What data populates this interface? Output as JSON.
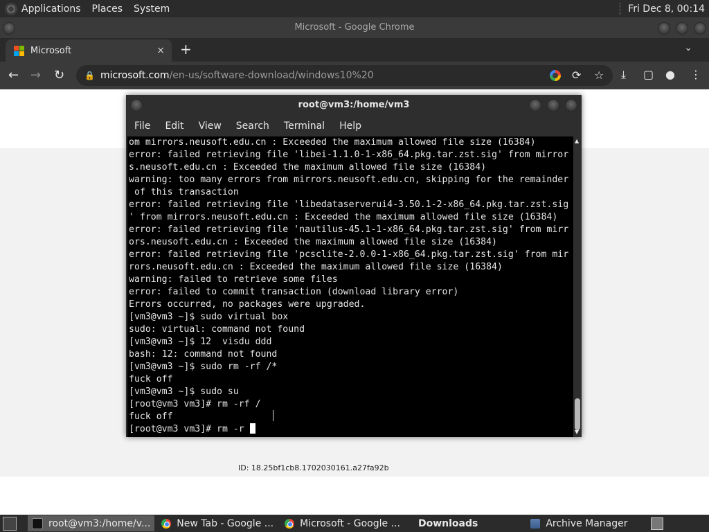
{
  "top_panel": {
    "menus": [
      "Applications",
      "Places",
      "System"
    ],
    "clock": "Fri Dec 8, 00:14"
  },
  "chrome": {
    "window_title": "Microsoft - Google Chrome",
    "tab": {
      "title": "Microsoft",
      "close": "×"
    },
    "new_tab": "+",
    "tab_menu": "⌄",
    "url_host": "microsoft.com",
    "url_path": "/en-us/software-download/windows10%20",
    "icons": [
      "back-icon",
      "forward-icon",
      "reload-icon",
      "lock-icon",
      "google-lens-icon",
      "share-icon",
      "star-icon",
      "download-icon",
      "side-panel-icon",
      "profile-icon",
      "more-icon"
    ]
  },
  "page": {
    "id_text": "ID: 18.25bf1cb8.1702030161.a27fa92b"
  },
  "terminal": {
    "title": "root@vm3:/home/vm3",
    "menu": [
      "File",
      "Edit",
      "View",
      "Search",
      "Terminal",
      "Help"
    ],
    "lines": [
      "om mirrors.neusoft.edu.cn : Exceeded the maximum allowed file size (16384)",
      "error: failed retrieving file 'libei-1.1.0-1-x86_64.pkg.tar.zst.sig' from mirror",
      "s.neusoft.edu.cn : Exceeded the maximum allowed file size (16384)",
      "warning: too many errors from mirrors.neusoft.edu.cn, skipping for the remainder",
      " of this transaction",
      "error: failed retrieving file 'libedataserverui4-3.50.1-2-x86_64.pkg.tar.zst.sig",
      "' from mirrors.neusoft.edu.cn : Exceeded the maximum allowed file size (16384)",
      "error: failed retrieving file 'nautilus-45.1-1-x86_64.pkg.tar.zst.sig' from mirr",
      "ors.neusoft.edu.cn : Exceeded the maximum allowed file size (16384)",
      "error: failed retrieving file 'pcsclite-2.0.0-1-x86_64.pkg.tar.zst.sig' from mir",
      "rors.neusoft.edu.cn : Exceeded the maximum allowed file size (16384)",
      "warning: failed to retrieve some files",
      "error: failed to commit transaction (download library error)",
      "Errors occurred, no packages were upgraded.",
      "[vm3@vm3 ~]$ sudo virtual box",
      "sudo: virtual: command not found",
      "[vm3@vm3 ~]$ 12  visdu ddd",
      "bash: 12: command not found",
      "[vm3@vm3 ~]$ sudo rm -rf /*",
      "fuck off",
      "[vm3@vm3 ~]$ sudo su",
      "[root@vm3 vm3]# rm -rf /",
      "fuck off"
    ],
    "prompt_line": "[root@vm3 vm3]# rm -r "
  },
  "taskbar": {
    "tasks": [
      {
        "label": "root@vm3:/home/v...",
        "icon": "terminal-icon",
        "active": true
      },
      {
        "label": "New Tab - Google ...",
        "icon": "chrome-icon",
        "active": false
      },
      {
        "label": "Microsoft - Google ...",
        "icon": "chrome-icon",
        "active": false
      },
      {
        "label": "Downloads",
        "icon": "folder-icon",
        "active": false,
        "bold": true
      },
      {
        "label": "Archive Manager",
        "icon": "archive-icon",
        "active": false
      }
    ]
  }
}
